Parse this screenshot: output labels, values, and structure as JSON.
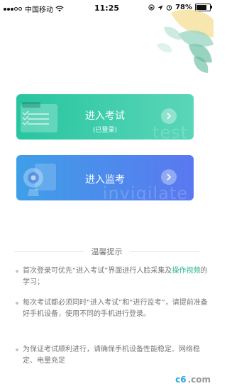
{
  "status_bar": {
    "carrier": "中国移动",
    "time": "11:25",
    "battery": "78%",
    "battery_level": 0.78,
    "icons": [
      "signal-dots-icon",
      "wifi-icon",
      "lock-rotation-icon",
      "location-arrow-icon",
      "alarm-icon",
      "battery-icon"
    ]
  },
  "cards": {
    "exam": {
      "title": "进入考试",
      "subtitle": "(已登录)",
      "watermark": "test",
      "color_start": "#27c5a0",
      "color_end": "#5ad6b8"
    },
    "monitor": {
      "title": "进入监考",
      "watermark": "invigilate",
      "color_start": "#3f9fe8",
      "color_end": "#5a78f0"
    }
  },
  "tips": {
    "title": "温馨提示",
    "items": [
      {
        "text": "首次登录可优先“进入考试”界面进行人脸采集及",
        "link": "操作视频",
        "suffix": "的学习；"
      },
      {
        "text": "每次考试都必须同时“进入考试”和“进行监考”，请提前准备好手机设备，使用不同的手机进行登录。"
      },
      {
        "text": "为保证考试顺利进行，请确保手机设备性能稳定、网络稳定、电量充足"
      }
    ]
  },
  "watermark": {
    "text_c6": "c6",
    "text_com": ".com"
  }
}
